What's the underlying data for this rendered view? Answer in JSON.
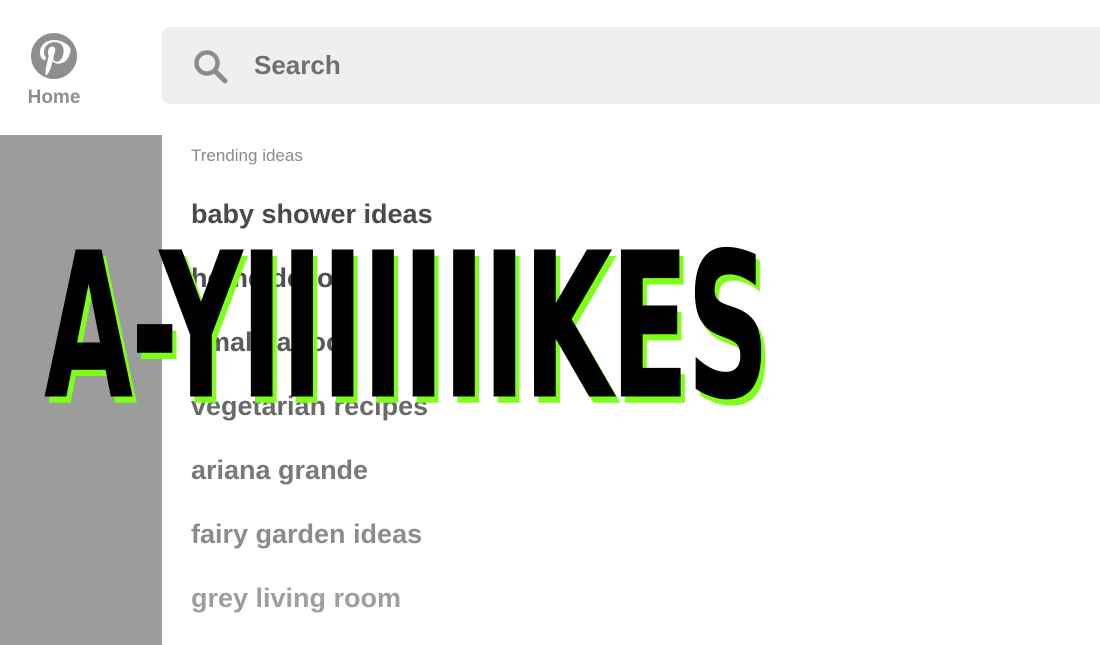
{
  "nav": {
    "logo_icon": "pinterest-logo-icon",
    "home_label": "Home"
  },
  "search": {
    "icon": "search-icon",
    "placeholder": "Search"
  },
  "dropdown": {
    "heading": "Trending ideas",
    "suggestions": [
      "baby shower ideas",
      "home decor",
      "small tattoos",
      "vegetarian recipes",
      "ariana grande",
      "fairy garden ideas",
      "grey living room"
    ]
  },
  "overlay": {
    "text": "A-YIIIIIIIKES",
    "text_color": "#000000",
    "shadow_color": "#7dff1a"
  },
  "colors": {
    "dim_overlay": "#9c9c9c",
    "search_bg": "#efefef",
    "brand_icon": "#8e8e8e"
  }
}
